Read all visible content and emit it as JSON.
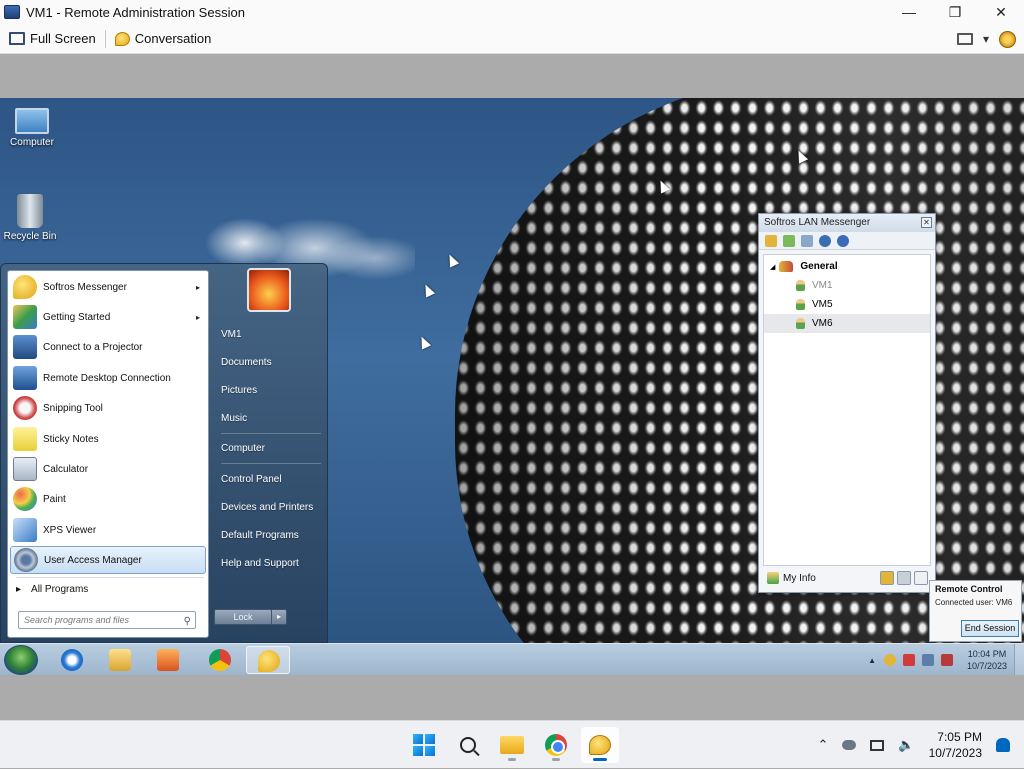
{
  "window": {
    "title": "VM1 - Remote Administration Session"
  },
  "toolbar": {
    "fullscreen_label": "Full Screen",
    "conversation_label": "Conversation",
    "dropdown_glyph": "▾"
  },
  "window_controls": {
    "minimize": "—",
    "maximize": "❐",
    "close": "✕"
  },
  "desktop": {
    "icons": [
      {
        "label": "Computer"
      },
      {
        "label": "Recycle Bin"
      }
    ]
  },
  "start_menu": {
    "programs": [
      {
        "label": "Softros Messenger",
        "has_submenu": true,
        "icon": "messenger-icon"
      },
      {
        "label": "Getting Started",
        "has_submenu": true,
        "icon": "getting-started-icon"
      },
      {
        "label": "Connect to a Projector",
        "icon": "projector-icon"
      },
      {
        "label": "Remote Desktop Connection",
        "icon": "remote-desktop-icon"
      },
      {
        "label": "Snipping Tool",
        "icon": "snipping-tool-icon"
      },
      {
        "label": "Sticky Notes",
        "icon": "sticky-notes-icon"
      },
      {
        "label": "Calculator",
        "icon": "calculator-icon"
      },
      {
        "label": "Paint",
        "icon": "paint-icon"
      },
      {
        "label": "XPS Viewer",
        "icon": "xps-viewer-icon"
      },
      {
        "label": "User Access Manager",
        "icon": "user-access-manager-icon",
        "highlighted": true
      }
    ],
    "all_programs": "All Programs",
    "search_placeholder": "Search programs and files",
    "right_items": [
      "VM1",
      "Documents",
      "Pictures",
      "Music",
      "Computer",
      "Control Panel",
      "Devices and Printers",
      "Default Programs",
      "Help and Support"
    ],
    "lock_label": "Lock",
    "submenu_glyph": "▸",
    "lock_arrow_glyph": "▸",
    "search_glyph": "⚲"
  },
  "messenger": {
    "title": "Softros LAN Messenger",
    "close_glyph": "✕",
    "group": "General",
    "group_toggle": "◢",
    "users": [
      {
        "name": "VM1",
        "offline": true
      },
      {
        "name": "VM5"
      },
      {
        "name": "VM6",
        "selected": true
      }
    ],
    "my_info": "My Info"
  },
  "remote_control": {
    "title": "Remote Control",
    "connected_user": "Connected user: VM6",
    "end_button": "End Session"
  },
  "remote_taskbar": {
    "time": "10:04 PM",
    "date": "10/7/2023",
    "tray_chevron": "▲"
  },
  "host_taskbar": {
    "time": "7:05 PM",
    "date": "10/7/2023",
    "tray_chevron": "⌃",
    "volume_glyph": "🔈"
  },
  "colors": {
    "accent": "#0067c0",
    "remote_taskbar": "#9db5cc"
  }
}
